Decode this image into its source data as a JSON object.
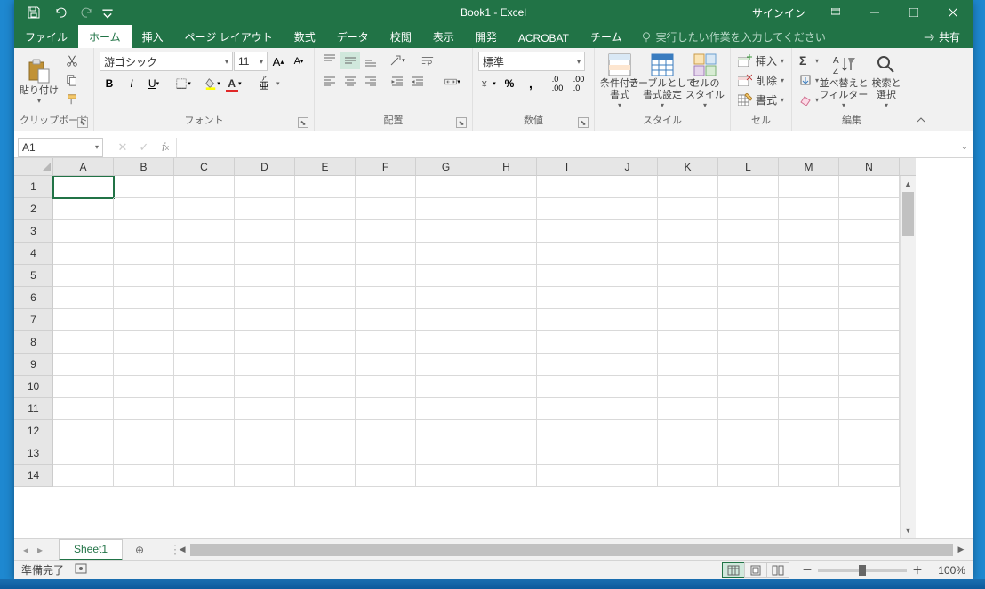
{
  "title": "Book1 - Excel",
  "signin": "サインイン",
  "share": "共有",
  "tabs": {
    "file": "ファイル",
    "home": "ホーム",
    "insert": "挿入",
    "layout": "ページ レイアウト",
    "formula": "数式",
    "data": "データ",
    "review": "校閲",
    "view": "表示",
    "developer": "開発",
    "acrobat": "ACROBAT",
    "team": "チーム"
  },
  "tellme": "実行したい作業を入力してください",
  "groups": {
    "clipboard": {
      "label": "クリップボード",
      "paste": "貼り付け"
    },
    "font": {
      "label": "フォント",
      "name": "游ゴシック",
      "size": "11"
    },
    "align": {
      "label": "配置"
    },
    "number": {
      "label": "数値",
      "format": "標準"
    },
    "styles": {
      "label": "スタイル",
      "cond": "条件付き\n書式",
      "table": "テーブルとして\n書式設定",
      "cell": "セルの\nスタイル"
    },
    "cells": {
      "label": "セル",
      "insert": "挿入",
      "delete": "削除",
      "format": "書式"
    },
    "editing": {
      "label": "編集",
      "sort": "並べ替えと\nフィルター",
      "find": "検索と\n選択"
    }
  },
  "namebox": "A1",
  "columns": [
    "A",
    "B",
    "C",
    "D",
    "E",
    "F",
    "G",
    "H",
    "I",
    "J",
    "K",
    "L",
    "M",
    "N"
  ],
  "rows": [
    "1",
    "2",
    "3",
    "4",
    "5",
    "6",
    "7",
    "8",
    "9",
    "10",
    "11",
    "12",
    "13",
    "14"
  ],
  "sheet": "Sheet1",
  "status": "準備完了",
  "zoom": "100%"
}
